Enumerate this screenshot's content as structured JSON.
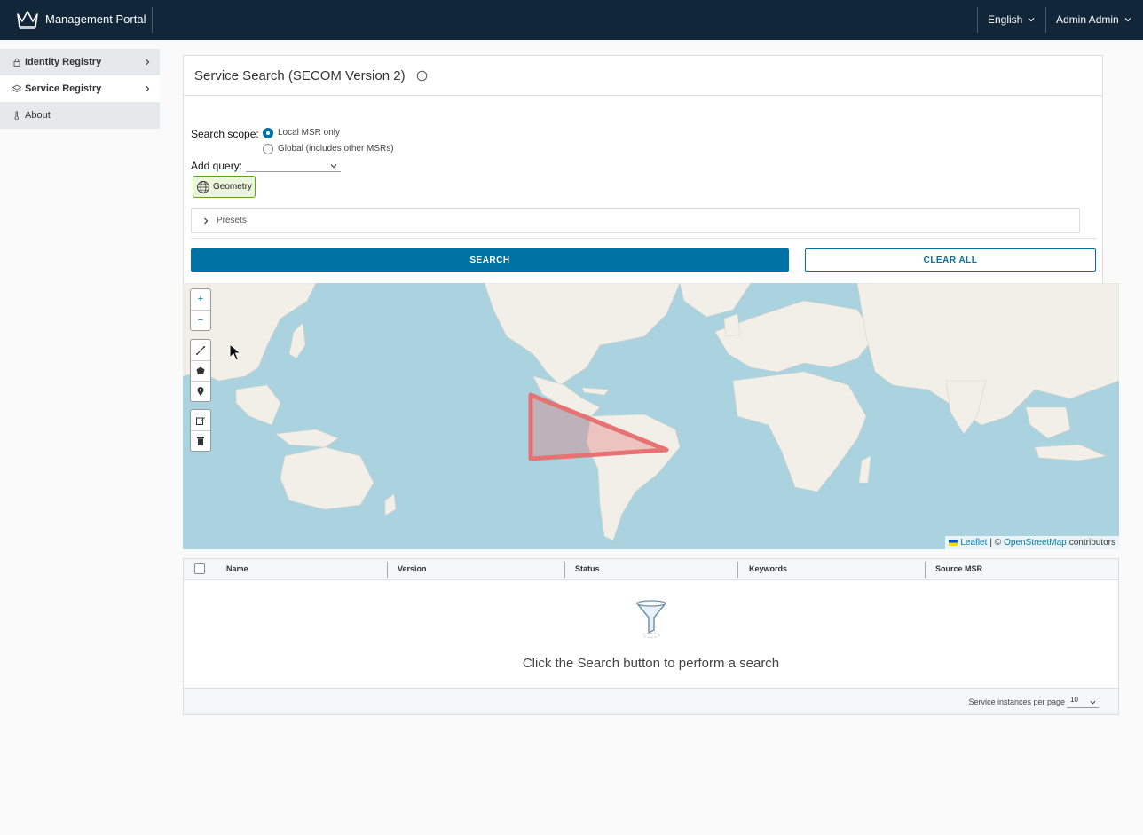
{
  "header": {
    "app_title": "Management Portal",
    "language": "English",
    "user": "Admin Admin"
  },
  "sidebar": {
    "items": [
      {
        "label": "Identity Registry",
        "icon": "lock-icon"
      },
      {
        "label": "Service Registry",
        "icon": "layers-icon"
      },
      {
        "label": "About",
        "icon": "thermometer-icon"
      }
    ]
  },
  "search": {
    "title": "Service Search (SECOM Version 2)",
    "scope_label": "Search scope:",
    "scope_options": [
      "Local MSR only",
      "Global (includes other MSRs)"
    ],
    "scope_selected": "Local MSR only",
    "add_query_label": "Add query:",
    "add_query_value": "",
    "chip_label": "Geometry",
    "presets_label": "Presets",
    "search_button": "SEARCH",
    "clear_button": "CLEAR ALL"
  },
  "map": {
    "zoom_in": "+",
    "zoom_out": "−",
    "attribution_leaflet": "Leaflet",
    "attribution_sep": "| ©",
    "attribution_osm": "OpenStreetMap",
    "attribution_contrib": "contributors",
    "drawn_shape": "polygon",
    "shape_color": "#e57373"
  },
  "table": {
    "columns": [
      "Name",
      "Version",
      "Status",
      "Keywords",
      "Source MSR"
    ],
    "empty_message": "Click the Search button to perform a search",
    "per_page_label": "Service instances per page",
    "per_page_value": "10"
  },
  "colors": {
    "header_bg": "#12263a",
    "accent": "#0072a3",
    "chip_border": "#5aa220",
    "ocean": "#aad3df",
    "land": "#f2efe9"
  }
}
